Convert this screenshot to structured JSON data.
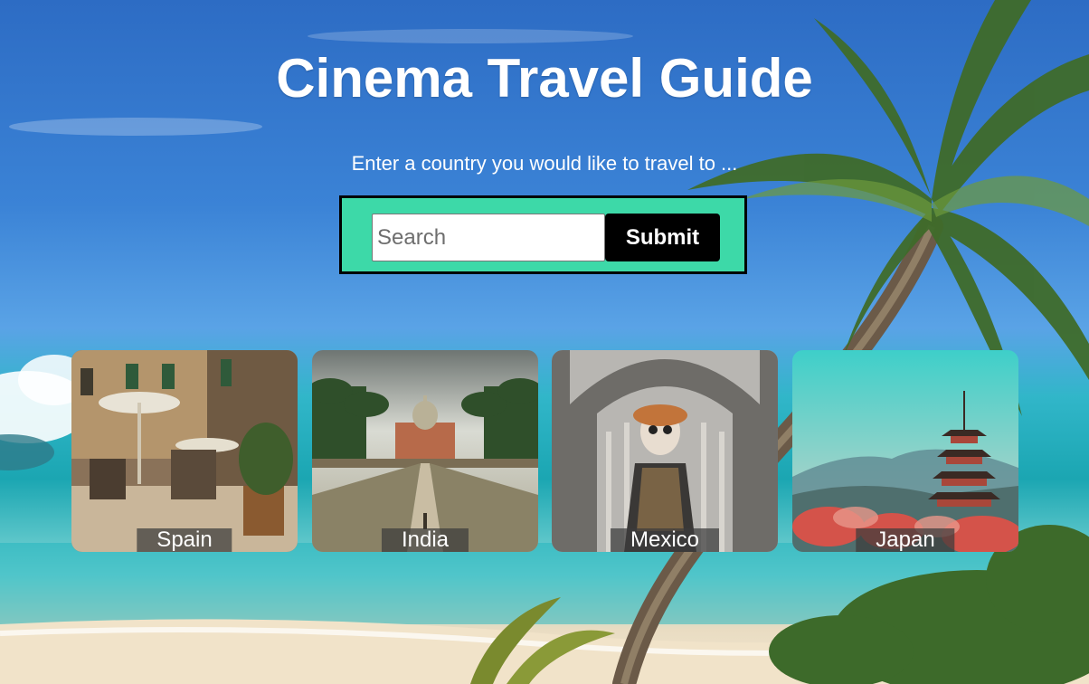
{
  "header": {
    "title": "Cinema Travel Guide",
    "subtitle": "Enter a country you would like to travel to ..."
  },
  "search": {
    "placeholder": "Search",
    "value": "",
    "submit_label": "Submit"
  },
  "colors": {
    "search_panel": "#3dd9a8",
    "submit_button": "#000000",
    "title_text": "#ffffff"
  },
  "destinations": [
    {
      "name": "Spain",
      "image": "street-cafe-photo"
    },
    {
      "name": "India",
      "image": "palace-avenue-photo"
    },
    {
      "name": "Mexico",
      "image": "day-of-the-dead-cathedral-photo"
    },
    {
      "name": "Japan",
      "image": "pagoda-mountain-photo"
    }
  ],
  "background": {
    "image": "tropical-beach-palm-photo"
  }
}
